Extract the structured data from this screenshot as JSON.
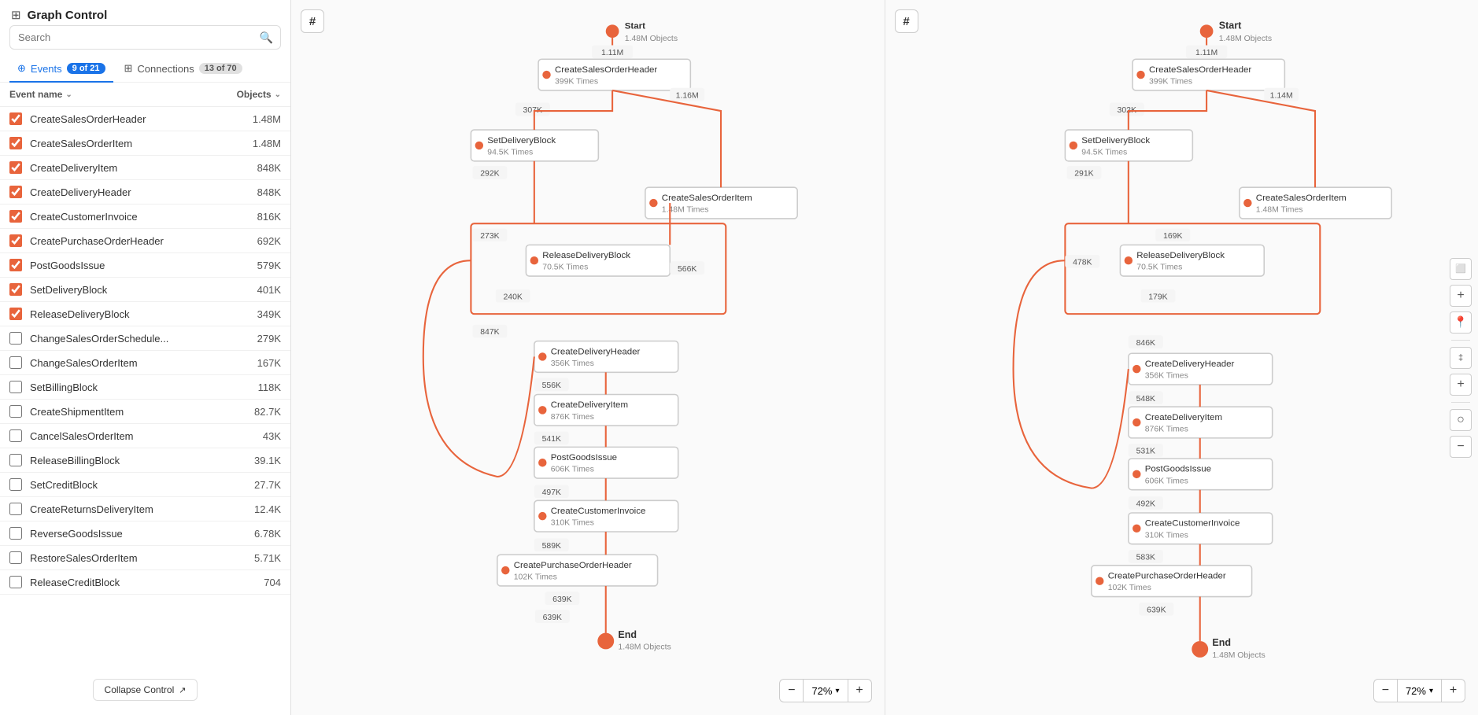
{
  "panel": {
    "hash_icon": "#",
    "title": "Graph Control",
    "search_placeholder": "Search",
    "tabs": [
      {
        "id": "events",
        "label": "Events",
        "badge": "9 of 21",
        "active": true
      },
      {
        "id": "connections",
        "label": "Connections",
        "badge": "13 of 70",
        "active": false
      }
    ],
    "table_header": {
      "name_col": "Event name",
      "objects_col": "Objects"
    },
    "events": [
      {
        "name": "CreateSalesOrderHeader",
        "count": "1.48M",
        "checked": true
      },
      {
        "name": "CreateSalesOrderItem",
        "count": "1.48M",
        "checked": true
      },
      {
        "name": "CreateDeliveryItem",
        "count": "848K",
        "checked": true
      },
      {
        "name": "CreateDeliveryHeader",
        "count": "848K",
        "checked": true
      },
      {
        "name": "CreateCustomerInvoice",
        "count": "816K",
        "checked": true
      },
      {
        "name": "CreatePurchaseOrderHeader",
        "count": "692K",
        "checked": true
      },
      {
        "name": "PostGoodsIssue",
        "count": "579K",
        "checked": true
      },
      {
        "name": "SetDeliveryBlock",
        "count": "401K",
        "checked": true
      },
      {
        "name": "ReleaseDeliveryBlock",
        "count": "349K",
        "checked": true
      },
      {
        "name": "ChangeSalesOrderSchedule...",
        "count": "279K",
        "checked": false
      },
      {
        "name": "ChangeSalesOrderItem",
        "count": "167K",
        "checked": false
      },
      {
        "name": "SetBillingBlock",
        "count": "118K",
        "checked": false
      },
      {
        "name": "CreateShipmentItem",
        "count": "82.7K",
        "checked": false
      },
      {
        "name": "CancelSalesOrderItem",
        "count": "43K",
        "checked": false
      },
      {
        "name": "ReleaseBillingBlock",
        "count": "39.1K",
        "checked": false
      },
      {
        "name": "SetCreditBlock",
        "count": "27.7K",
        "checked": false
      },
      {
        "name": "CreateReturnsDeliveryItem",
        "count": "12.4K",
        "checked": false
      },
      {
        "name": "ReverseGoodsIssue",
        "count": "6.78K",
        "checked": false
      },
      {
        "name": "RestoreSalesOrderItem",
        "count": "5.71K",
        "checked": false
      },
      {
        "name": "ReleaseCreditBlock",
        "count": "704",
        "checked": false
      }
    ],
    "collapse_btn": "Collapse Control"
  },
  "graph_left": {
    "hash_icon": "#",
    "zoom_minus": "−",
    "zoom_level": "72%",
    "zoom_plus": "+",
    "nodes": {
      "start": {
        "label": "Start",
        "sublabel": "1.48M Objects",
        "count": "1.11M"
      },
      "createSalesOrderHeader": {
        "label": "CreateSalesOrderHeader",
        "sublabel": "399K Times",
        "inflow": "307K",
        "outflow": "1.16M"
      },
      "setDeliveryBlock": {
        "label": "SetDeliveryBlock",
        "sublabel": "94.5K Times",
        "inflow": "292K",
        "outflow": ""
      },
      "createSalesOrderItem": {
        "label": "CreateSalesOrderItem",
        "sublabel": "1.48M Times"
      },
      "releaseDeliveryBlock": {
        "label": "ReleaseDeliveryBlock",
        "sublabel": "70.5K Times",
        "inflow": "273K",
        "outflow": "566K",
        "bottom": "240K"
      },
      "createDeliveryHeader": {
        "label": "CreateDeliveryHeader",
        "sublabel": "356K Times",
        "inflow": "847K"
      },
      "createDeliveryItem": {
        "label": "CreateDeliveryItem",
        "sublabel": "876K Times",
        "inflow": "556K"
      },
      "postGoodsIssue": {
        "label": "PostGoodsIssue",
        "sublabel": "606K Times",
        "inflow": "541K"
      },
      "createCustomerInvoice": {
        "label": "CreateCustomerInvoice",
        "sublabel": "310K Times",
        "inflow": "497K"
      },
      "createPurchaseOrderHeader": {
        "label": "CreatePurchaseOrderHeader",
        "sublabel": "102K Times",
        "inflow": "589K"
      },
      "end": {
        "label": "End",
        "sublabel": "1.48M Objects",
        "inflow": "639K"
      }
    }
  },
  "graph_right": {
    "hash_icon": "#",
    "zoom_minus": "−",
    "zoom_level": "72%",
    "zoom_plus": "+",
    "sidebar_btns": [
      "‡",
      "+",
      "−",
      "○",
      "−"
    ],
    "nodes": {
      "start": {
        "label": "Start",
        "sublabel": "1.48M Objects",
        "count": "1.11M"
      },
      "createSalesOrderHeader": {
        "label": "CreateSalesOrderHeader",
        "sublabel": "399K Times",
        "inflow": "302K",
        "outflow": "1.14M"
      },
      "setDeliveryBlock": {
        "label": "SetDeliveryBlock",
        "sublabel": "94.5K Times",
        "inflow": "291K"
      },
      "createSalesOrderItem": {
        "label": "CreateSalesOrderItem",
        "sublabel": "1.48M Times"
      },
      "releaseDeliveryBlock": {
        "label": "ReleaseDeliveryBlock",
        "sublabel": "70.5K Times",
        "inflow": "169K",
        "left": "478K",
        "bottom": "179K"
      },
      "createDeliveryHeader": {
        "label": "CreateDeliveryHeader",
        "sublabel": "356K Times",
        "inflow": "846K"
      },
      "createDeliveryItem": {
        "label": "CreateDeliveryItem",
        "sublabel": "876K Times",
        "inflow": "548K"
      },
      "postGoodsIssue": {
        "label": "PostGoodsIssue",
        "sublabel": "606K Times",
        "inflow": "531K"
      },
      "createCustomerInvoice": {
        "label": "CreateCustomerInvoice",
        "sublabel": "310K Times",
        "inflow": "492K"
      },
      "createPurchaseOrderHeader": {
        "label": "CreatePurchaseOrderHeader",
        "sublabel": "102K Times",
        "inflow": "583K"
      },
      "end": {
        "label": "End",
        "sublabel": "1.48M Objects",
        "inflow": "639K"
      }
    }
  }
}
